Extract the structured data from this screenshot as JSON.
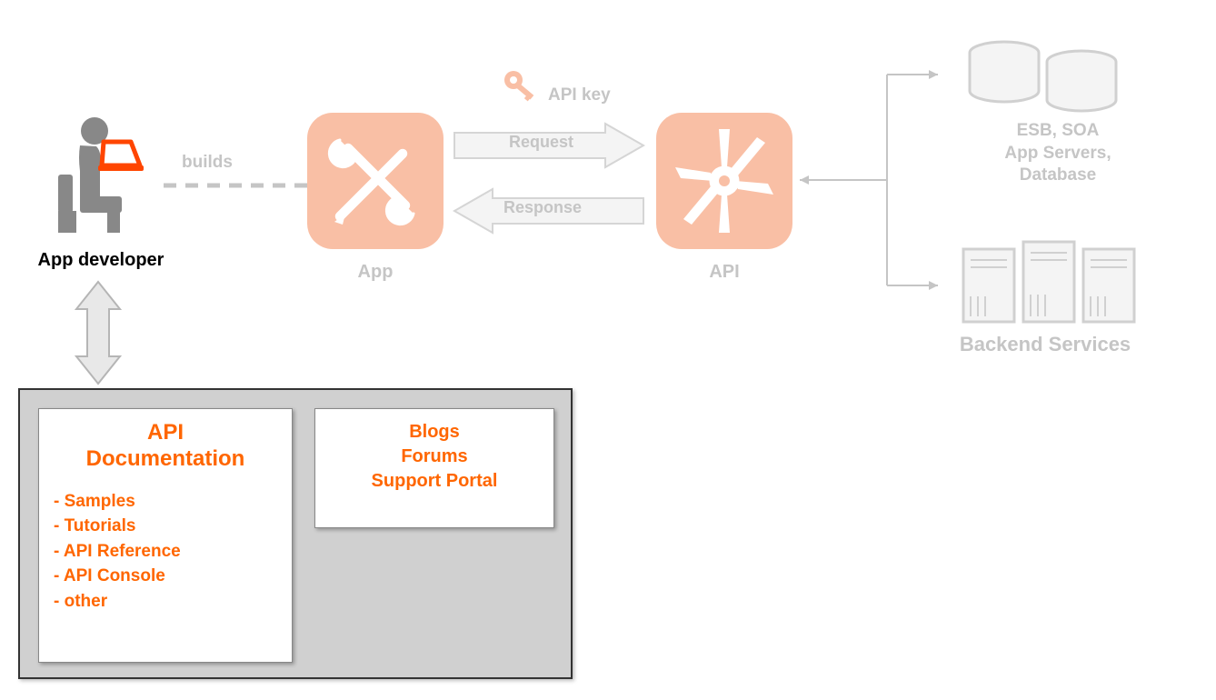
{
  "developer": {
    "label": "App developer"
  },
  "connect": {
    "builds": "builds"
  },
  "app": {
    "label": "App"
  },
  "flow": {
    "apiKey": "API key",
    "request": "Request",
    "response": "Response"
  },
  "api": {
    "label": "API"
  },
  "backend": {
    "l1": "ESB, SOA",
    "l2": "App Servers,",
    "l3": "Database",
    "label": "Backend Services"
  },
  "docs": {
    "title1": "API",
    "title2": "Documentation",
    "items": {
      "i0": "- Samples",
      "i1": "- Tutorials",
      "i2": "- API Reference",
      "i3": "- API Console",
      "i4": "- other"
    }
  },
  "community": {
    "l0": "Blogs",
    "l1": "Forums",
    "l2": "Support Portal"
  }
}
